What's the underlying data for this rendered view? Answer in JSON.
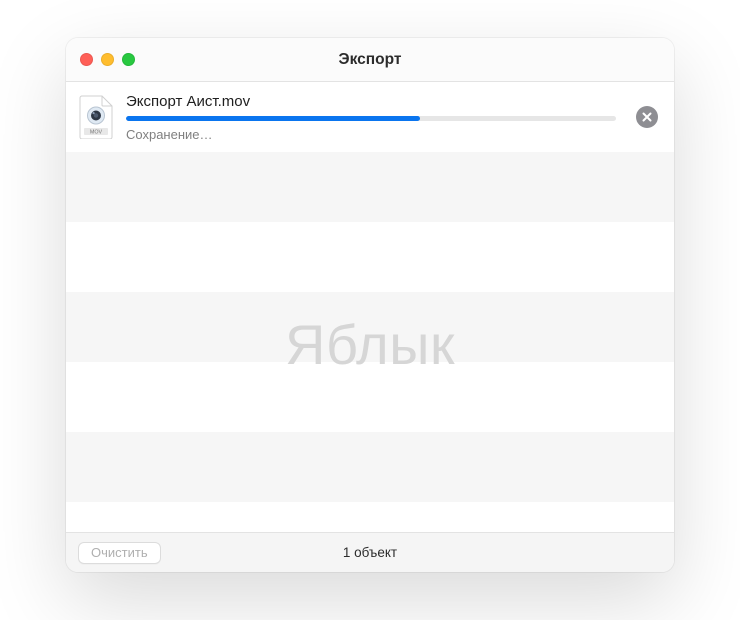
{
  "titlebar": {
    "title": "Экспорт"
  },
  "export_item": {
    "filetype_label": "MOV",
    "filename": "Экспорт Аист.mov",
    "status": "Сохранение…",
    "progress_percent": 60
  },
  "watermark": "Яблык",
  "footer": {
    "clear_label": "Очистить",
    "count_label": "1 объект"
  },
  "colors": {
    "progress_fill": "#0a75ef",
    "traffic_close": "#ff5f57",
    "traffic_min": "#ffbd2e",
    "traffic_zoom": "#28c840"
  }
}
